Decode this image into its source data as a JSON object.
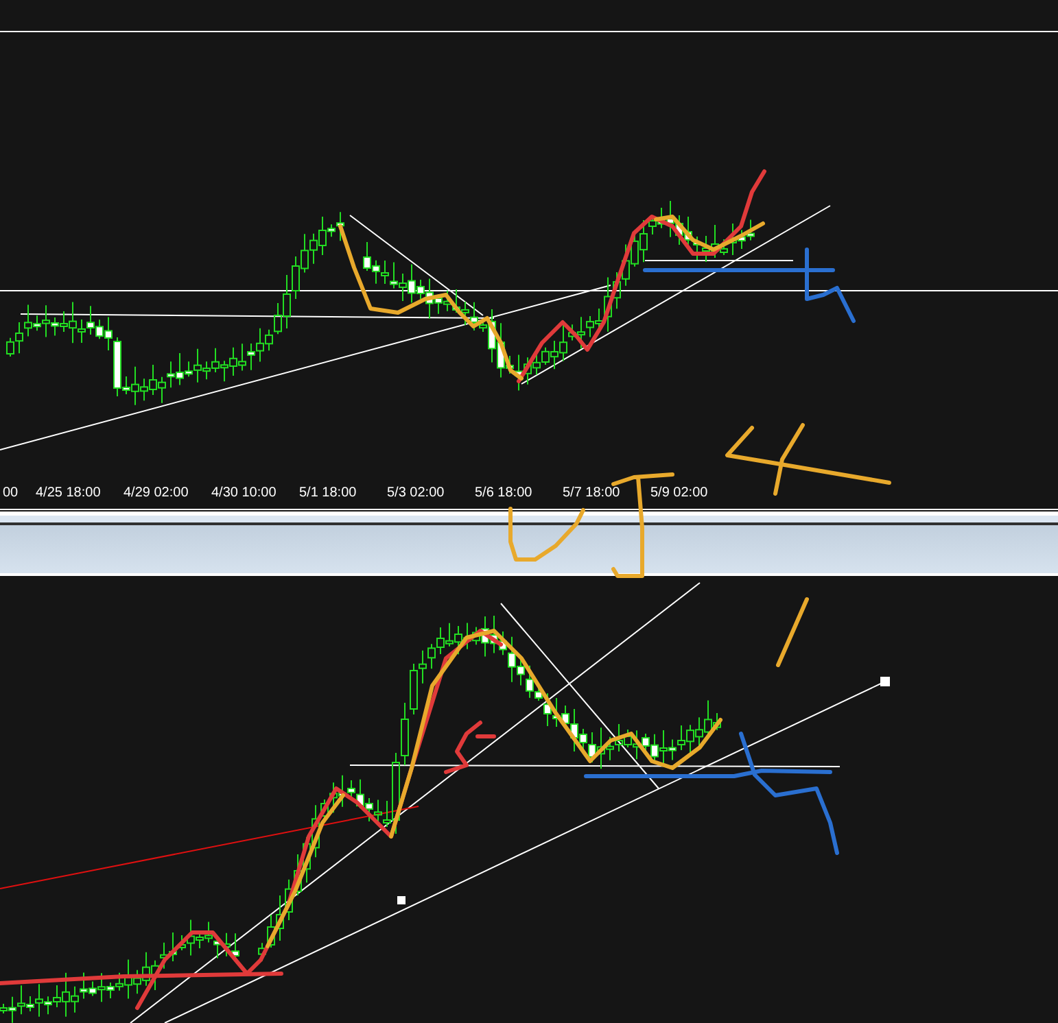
{
  "top_chart": {
    "time_axis": {
      "labels": [
        "00",
        "4/25 18:00",
        "4/29 02:00",
        "4/30 10:00",
        "5/1 18:00",
        "5/3 02:00",
        "5/6 18:00",
        "5/7 18:00",
        "5/9 02:00"
      ]
    }
  }
}
